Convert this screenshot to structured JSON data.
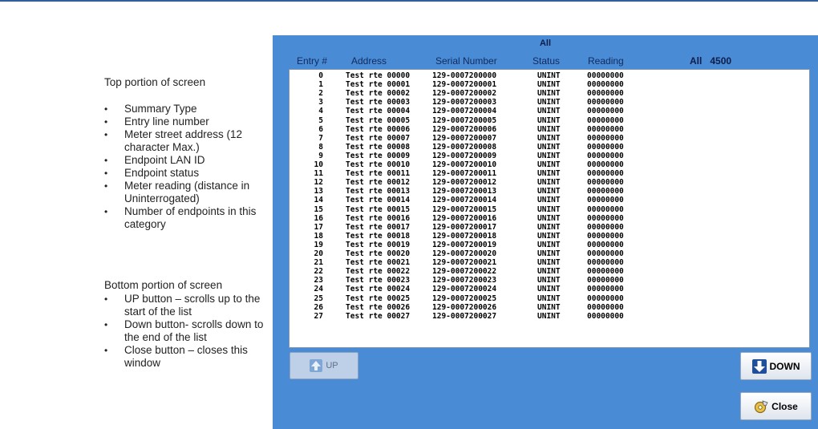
{
  "notes": {
    "top_heading": "Top portion of screen",
    "top_items": [
      "Summary Type",
      "Entry line number",
      "Meter street address (12 character Max.)",
      "Endpoint LAN ID",
      "Endpoint status",
      "Meter reading (distance in Uninterrogated)",
      "Number of endpoints in this category"
    ],
    "bottom_heading": "Bottom portion of screen",
    "bottom_items": [
      "UP button – scrolls up to the start of the list",
      "Down button- scrolls down to the end of the list",
      "Close button – closes this window"
    ]
  },
  "screen": {
    "summary_type": "All",
    "columns": {
      "entry": "Entry #",
      "address": "Address",
      "serial": "Serial Number",
      "status": "Status",
      "reading": "Reading"
    },
    "count_label": "All",
    "count_value": "4500",
    "rows": [
      [
        "0",
        "Test rte 00000",
        "129-0007200000",
        "UNINT",
        "00000000"
      ],
      [
        "1",
        "Test rte 00001",
        "129-0007200001",
        "UNINT",
        "00000000"
      ],
      [
        "2",
        "Test rte 00002",
        "129-0007200002",
        "UNINT",
        "00000000"
      ],
      [
        "3",
        "Test rte 00003",
        "129-0007200003",
        "UNINT",
        "00000000"
      ],
      [
        "4",
        "Test rte 00004",
        "129-0007200004",
        "UNINT",
        "00000000"
      ],
      [
        "5",
        "Test rte 00005",
        "129-0007200005",
        "UNINT",
        "00000000"
      ],
      [
        "6",
        "Test rte 00006",
        "129-0007200006",
        "UNINT",
        "00000000"
      ],
      [
        "7",
        "Test rte 00007",
        "129-0007200007",
        "UNINT",
        "00000000"
      ],
      [
        "8",
        "Test rte 00008",
        "129-0007200008",
        "UNINT",
        "00000000"
      ],
      [
        "9",
        "Test rte 00009",
        "129-0007200009",
        "UNINT",
        "00000000"
      ],
      [
        "10",
        "Test rte 00010",
        "129-0007200010",
        "UNINT",
        "00000000"
      ],
      [
        "11",
        "Test rte 00011",
        "129-0007200011",
        "UNINT",
        "00000000"
      ],
      [
        "12",
        "Test rte 00012",
        "129-0007200012",
        "UNINT",
        "00000000"
      ],
      [
        "13",
        "Test rte 00013",
        "129-0007200013",
        "UNINT",
        "00000000"
      ],
      [
        "14",
        "Test rte 00014",
        "129-0007200014",
        "UNINT",
        "00000000"
      ],
      [
        "15",
        "Test rte 00015",
        "129-0007200015",
        "UNINT",
        "00000000"
      ],
      [
        "16",
        "Test rte 00016",
        "129-0007200016",
        "UNINT",
        "00000000"
      ],
      [
        "17",
        "Test rte 00017",
        "129-0007200017",
        "UNINT",
        "00000000"
      ],
      [
        "18",
        "Test rte 00018",
        "129-0007200018",
        "UNINT",
        "00000000"
      ],
      [
        "19",
        "Test rte 00019",
        "129-0007200019",
        "UNINT",
        "00000000"
      ],
      [
        "20",
        "Test rte 00020",
        "129-0007200020",
        "UNINT",
        "00000000"
      ],
      [
        "21",
        "Test rte 00021",
        "129-0007200021",
        "UNINT",
        "00000000"
      ],
      [
        "22",
        "Test rte 00022",
        "129-0007200022",
        "UNINT",
        "00000000"
      ],
      [
        "23",
        "Test rte 00023",
        "129-0007200023",
        "UNINT",
        "00000000"
      ],
      [
        "24",
        "Test rte 00024",
        "129-0007200024",
        "UNINT",
        "00000000"
      ],
      [
        "25",
        "Test rte 00025",
        "129-0007200025",
        "UNINT",
        "00000000"
      ],
      [
        "26",
        "Test rte 00026",
        "129-0007200026",
        "UNINT",
        "00000000"
      ],
      [
        "27",
        "Test rte 00027",
        "129-0007200027",
        "UNINT",
        "00000000"
      ]
    ],
    "buttons": {
      "up": "UP",
      "down": "DOWN",
      "close": "Close"
    }
  },
  "colors": {
    "panel_bg": "#4a8bd6",
    "list_bg": "#ffffff",
    "header_text": "#102b5e",
    "up_arrow": "#7fa6d4",
    "down_arrow": "#1f4f9a"
  },
  "icons": {
    "up": "arrow-up-icon",
    "down": "arrow-down-icon",
    "close": "close-gear-icon"
  }
}
